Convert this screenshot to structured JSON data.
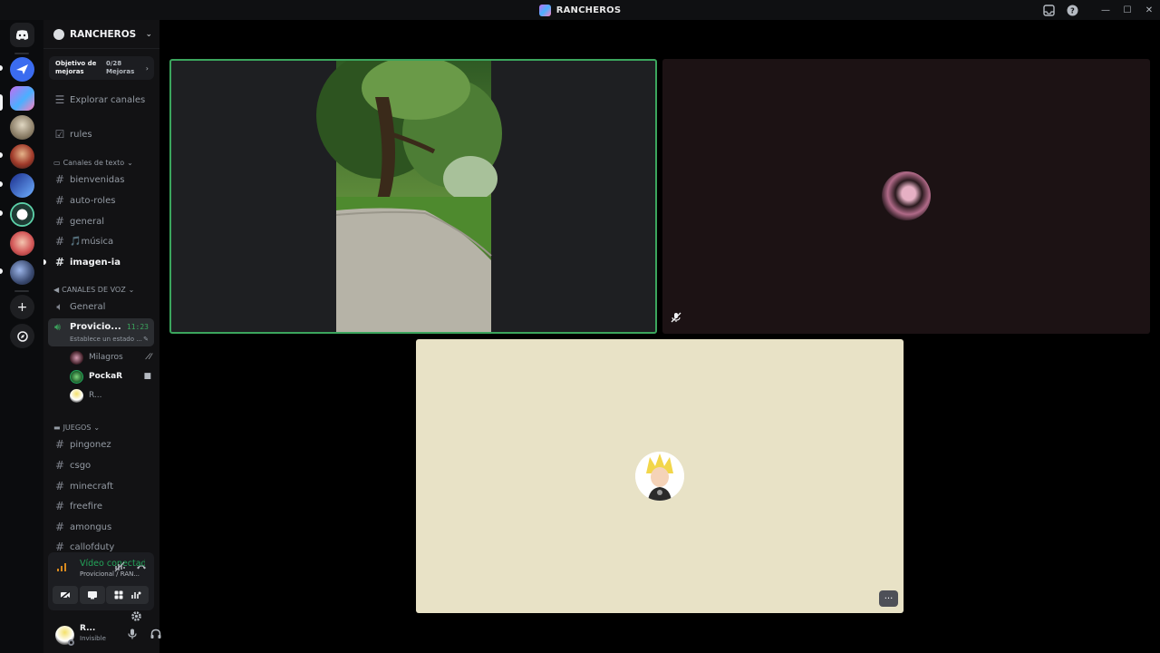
{
  "window": {
    "title": "RANCHEROS"
  },
  "guild": {
    "name": "RANCHEROS"
  },
  "boost": {
    "label": "Objetivo de mejoras",
    "count": "0/28",
    "unit": "Mejoras"
  },
  "top_items": [
    {
      "label": "Explorar canales"
    },
    {
      "label": "rules"
    }
  ],
  "categories": {
    "text": "Canales de texto",
    "voice": "CANALES DE VOZ",
    "games": "JUEGOS"
  },
  "text_channels": [
    {
      "name": "bienvenidas"
    },
    {
      "name": "auto-roles"
    },
    {
      "name": "general"
    },
    {
      "name": "🎵música"
    },
    {
      "name": "imagen-ia"
    }
  ],
  "voice_channels": {
    "general": "General",
    "active": {
      "name": "Provicio...",
      "time": "11:23",
      "status": "Establece un estado ..."
    },
    "users": [
      {
        "name": "Milagros"
      },
      {
        "name": "PockaR"
      },
      {
        "name": "R..."
      }
    ]
  },
  "game_channels": [
    {
      "name": "pingonez"
    },
    {
      "name": "csgo"
    },
    {
      "name": "minecraft"
    },
    {
      "name": "freefire"
    },
    {
      "name": "amongus"
    },
    {
      "name": "callofduty"
    }
  ],
  "voice_panel": {
    "title": "Vídeo conectado",
    "subtitle": "Provicional / RAN..."
  },
  "user": {
    "name": "R...",
    "status": "Invisible"
  },
  "colors": {
    "speaking_border": "#3ba55d",
    "connected_green": "#23a55a",
    "tile3_bg": "#e8e2c6"
  }
}
